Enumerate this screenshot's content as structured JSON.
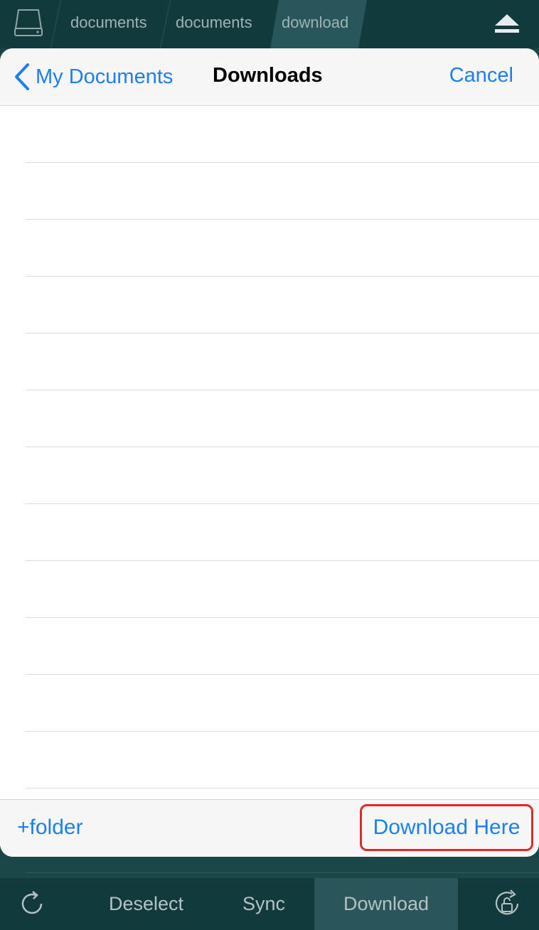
{
  "breadcrumb": {
    "items": [
      "documents",
      "documents",
      "download"
    ],
    "active_index": 2
  },
  "sheet": {
    "back_label": "My Documents",
    "title": "Downloads",
    "cancel_label": "Cancel",
    "row_count": 12,
    "new_folder_label": "+folder",
    "download_here_label": "Download Here"
  },
  "toolbar": {
    "deselect_label": "Deselect",
    "sync_label": "Sync",
    "download_label": "Download"
  },
  "colors": {
    "accent": "#1b7ff4",
    "highlight_box": "#e02a2a",
    "bar_bg": "#123a3d"
  },
  "icons": [
    "drive-icon",
    "eject-icon",
    "chevron-left-icon",
    "refresh-icon",
    "rotation-lock-icon"
  ]
}
